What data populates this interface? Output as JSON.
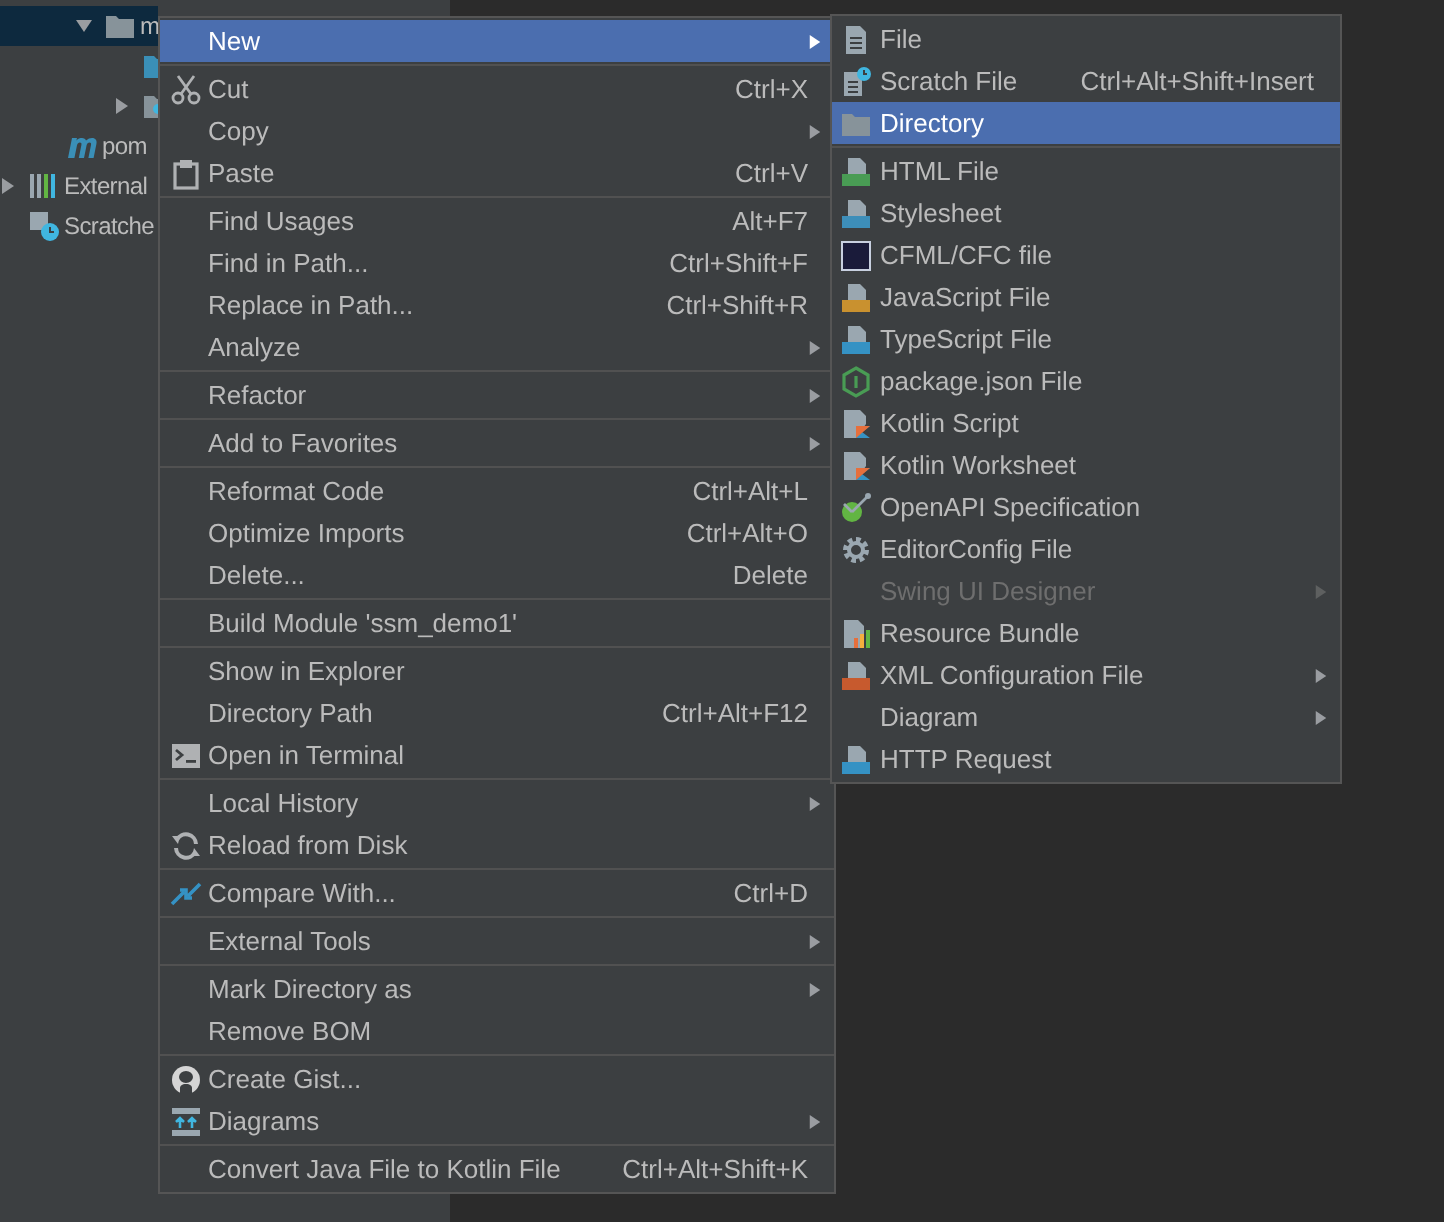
{
  "project_tree": {
    "rows": [
      {
        "label": "m",
        "kind": "folder",
        "expanded": true,
        "selected": true,
        "children": [
          {
            "kind": "blue-folder",
            "selected": false
          },
          {
            "kind": "package",
            "expanded": false,
            "selected": false
          }
        ]
      },
      {
        "label": "pom",
        "kind": "maven",
        "selected": false
      },
      {
        "label": "External",
        "kind": "libraries",
        "expanded": false,
        "selected": false
      },
      {
        "label": "Scratche",
        "kind": "scratches",
        "selected": false
      }
    ]
  },
  "context_menu": {
    "groups": [
      {
        "items": [
          {
            "label": "New",
            "has_submenu": true,
            "selected": true
          }
        ]
      },
      {
        "items": [
          {
            "label": "Cut",
            "shortcut": "Ctrl+X",
            "kind": "scissors",
            "has_submenu": false,
            "selected": false
          },
          {
            "label": "Copy",
            "has_submenu": true,
            "selected": false
          },
          {
            "label": "Paste",
            "shortcut": "Ctrl+V",
            "kind": "clipboard",
            "has_submenu": false,
            "selected": false
          }
        ]
      },
      {
        "items": [
          {
            "label": "Find Usages",
            "shortcut": "Alt+F7",
            "has_submenu": false,
            "selected": false
          },
          {
            "label": "Find in Path...",
            "shortcut": "Ctrl+Shift+F",
            "has_submenu": false,
            "selected": false
          },
          {
            "label": "Replace in Path...",
            "shortcut": "Ctrl+Shift+R",
            "has_submenu": false,
            "selected": false
          },
          {
            "label": "Analyze",
            "has_submenu": true,
            "selected": false
          }
        ]
      },
      {
        "items": [
          {
            "label": "Refactor",
            "has_submenu": true,
            "selected": false
          }
        ]
      },
      {
        "items": [
          {
            "label": "Add to Favorites",
            "has_submenu": true,
            "selected": false
          }
        ]
      },
      {
        "items": [
          {
            "label": "Reformat Code",
            "shortcut": "Ctrl+Alt+L",
            "has_submenu": false,
            "selected": false
          },
          {
            "label": "Optimize Imports",
            "shortcut": "Ctrl+Alt+O",
            "has_submenu": false,
            "selected": false
          },
          {
            "label": "Delete...",
            "shortcut": "Delete",
            "has_submenu": false,
            "selected": false
          }
        ]
      },
      {
        "items": [
          {
            "label": "Build Module 'ssm_demo1'",
            "has_submenu": false,
            "selected": false
          }
        ]
      },
      {
        "items": [
          {
            "label": "Show in Explorer",
            "has_submenu": false,
            "selected": false
          },
          {
            "label": "Directory Path",
            "shortcut": "Ctrl+Alt+F12",
            "has_submenu": false,
            "selected": false
          },
          {
            "label": "Open in Terminal",
            "kind": "terminal",
            "has_submenu": false,
            "selected": false
          }
        ]
      },
      {
        "items": [
          {
            "label": "Local History",
            "has_submenu": true,
            "selected": false
          },
          {
            "label": "Reload from Disk",
            "kind": "reload",
            "has_submenu": false,
            "selected": false
          }
        ]
      },
      {
        "items": [
          {
            "label": "Compare With...",
            "shortcut": "Ctrl+D",
            "kind": "compare",
            "has_submenu": false,
            "selected": false
          }
        ]
      },
      {
        "items": [
          {
            "label": "External Tools",
            "has_submenu": true,
            "selected": false
          }
        ]
      },
      {
        "items": [
          {
            "label": "Mark Directory as",
            "has_submenu": true,
            "selected": false
          },
          {
            "label": "Remove BOM",
            "has_submenu": false,
            "selected": false
          }
        ]
      },
      {
        "items": [
          {
            "label": "Create Gist...",
            "kind": "round-logo",
            "has_submenu": false,
            "selected": false
          },
          {
            "label": "Diagrams",
            "kind": "diagram",
            "has_submenu": true,
            "selected": false
          }
        ]
      },
      {
        "items": [
          {
            "label": "Convert Java File to Kotlin File",
            "shortcut": "Ctrl+Alt+Shift+K",
            "has_submenu": false,
            "selected": false
          }
        ]
      }
    ]
  },
  "new_submenu": {
    "groups": [
      {
        "items": [
          {
            "label": "File",
            "kind": "file",
            "has_submenu": false,
            "selected": false,
            "disabled": false
          },
          {
            "label": "Scratch File",
            "shortcut": "Ctrl+Alt+Shift+Insert",
            "kind": "scratch",
            "has_submenu": false,
            "selected": false,
            "disabled": false
          },
          {
            "label": "Directory",
            "kind": "folder",
            "has_submenu": false,
            "selected": true,
            "disabled": false
          }
        ]
      },
      {
        "items": [
          {
            "label": "HTML File",
            "kind": "html",
            "has_submenu": false,
            "selected": false,
            "disabled": false
          },
          {
            "label": "Stylesheet",
            "kind": "css",
            "has_submenu": false,
            "selected": false,
            "disabled": false
          },
          {
            "label": "CFML/CFC file",
            "kind": "cf",
            "has_submenu": false,
            "selected": false,
            "disabled": false
          },
          {
            "label": "JavaScript File",
            "kind": "js",
            "has_submenu": false,
            "selected": false,
            "disabled": false
          },
          {
            "label": "TypeScript File",
            "kind": "ts",
            "has_submenu": false,
            "selected": false,
            "disabled": false
          },
          {
            "label": "package.json File",
            "kind": "hexagon",
            "has_submenu": false,
            "selected": false,
            "disabled": false
          },
          {
            "label": "Kotlin Script",
            "kind": "kotlin",
            "has_submenu": false,
            "selected": false,
            "disabled": false
          },
          {
            "label": "Kotlin Worksheet",
            "kind": "kotlin",
            "has_submenu": false,
            "selected": false,
            "disabled": false
          },
          {
            "label": "OpenAPI Specification",
            "kind": "openapi",
            "has_submenu": false,
            "selected": false,
            "disabled": false
          },
          {
            "label": "EditorConfig File",
            "kind": "gear",
            "has_submenu": false,
            "selected": false,
            "disabled": false
          },
          {
            "label": "Swing UI Designer",
            "has_submenu": true,
            "selected": false,
            "disabled": true
          },
          {
            "label": "Resource Bundle",
            "kind": "bundle",
            "has_submenu": false,
            "selected": false,
            "disabled": false
          },
          {
            "label": "XML Configuration File",
            "kind": "xml",
            "has_submenu": true,
            "selected": false,
            "disabled": false
          },
          {
            "label": "Diagram",
            "has_submenu": true,
            "selected": false,
            "disabled": false
          },
          {
            "label": "HTTP Request",
            "kind": "api",
            "has_submenu": false,
            "selected": false,
            "disabled": false
          }
        ]
      }
    ]
  }
}
